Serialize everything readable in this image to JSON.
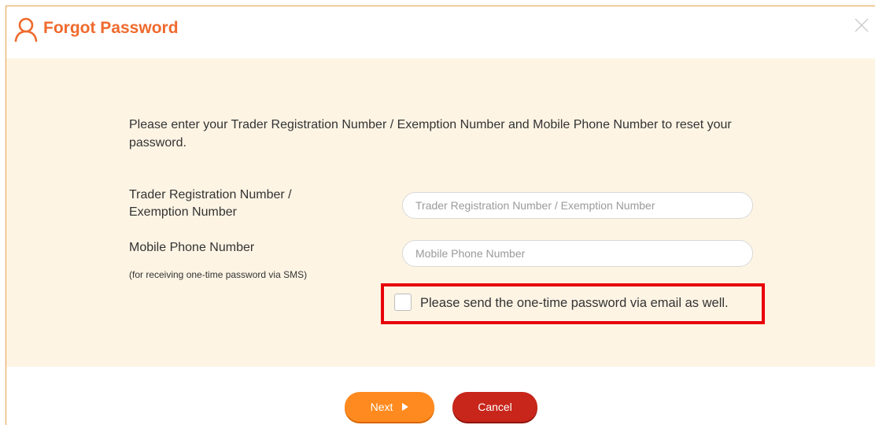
{
  "dialog": {
    "title": "Forgot Password",
    "title_icon": "user-icon",
    "close_icon": "close-icon"
  },
  "form": {
    "instruction": "Please enter your Trader Registration Number / Exemption Number and Mobile Phone Number to reset your password.",
    "trader_reg": {
      "label_line1": "Trader Registration Number /",
      "label_line2": "Exemption Number",
      "placeholder": "Trader Registration Number / Exemption Number",
      "value": ""
    },
    "mobile": {
      "label": "Mobile Phone Number",
      "hint": "(for receiving one-time password via SMS)",
      "placeholder": "Mobile Phone Number",
      "value": ""
    },
    "email_otp": {
      "label": "Please send the one-time password via email as well.",
      "checked": false
    }
  },
  "actions": {
    "next_label": "Next",
    "next_icon": "play-icon",
    "cancel_label": "Cancel"
  },
  "colors": {
    "accent": "#ef6a2c",
    "panel_bg": "#fdf4e4",
    "next_button": "#ff8a1f",
    "cancel_button": "#c8261b",
    "highlight": "#e8000b"
  }
}
